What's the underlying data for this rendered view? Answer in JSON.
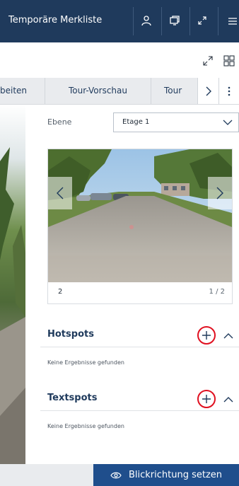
{
  "header": {
    "title": "Temporäre Merkliste",
    "icons": [
      "user-icon",
      "window-icon",
      "expand-icon",
      "menu-icon"
    ]
  },
  "toolbar": {
    "icons": [
      "expand-icon",
      "grid-icon"
    ]
  },
  "tabs": [
    {
      "label": "beiten",
      "active": false
    },
    {
      "label": "Tour-Vorschau",
      "active": false
    },
    {
      "label": "Tour",
      "active": false
    }
  ],
  "tab_controls": [
    "chevron-right-icon",
    "more-vertical-icon"
  ],
  "ebene": {
    "label": "Ebene",
    "selected": "Etage 1"
  },
  "image_card": {
    "index": "2",
    "count": "1 / 2"
  },
  "hotspots": {
    "title": "Hotspots",
    "empty": "Keine Ergebnisse gefunden"
  },
  "textspots": {
    "title": "Textspots",
    "empty": "Keine Ergebnisse gefunden"
  },
  "footer": {
    "button_label": "Blickrichtung setzen",
    "button_icon": "eye-icon"
  },
  "colors": {
    "header_bg": "#1f3a5c",
    "primary": "#1f4e8c",
    "highlight": "#e01020"
  }
}
